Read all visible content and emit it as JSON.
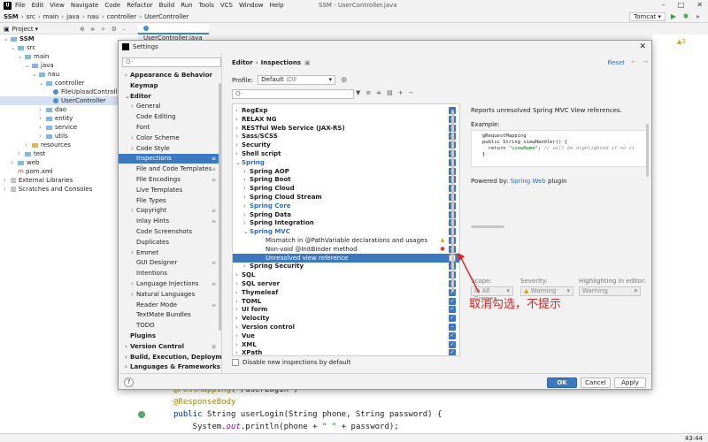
{
  "menubar": {
    "app_icon": "IJ",
    "items": [
      "File",
      "Edit",
      "View",
      "Navigate",
      "Code",
      "Refactor",
      "Build",
      "Run",
      "Tools",
      "VCS",
      "Window",
      "Help"
    ],
    "title": "SSM - UserController.java"
  },
  "navbar": {
    "crumbs": [
      "SSM",
      "src",
      "main",
      "java",
      "nau",
      "controller",
      "UserController"
    ],
    "run_config": "Tomcat"
  },
  "project_panel": {
    "title": "Project",
    "tree": [
      {
        "label": "SSM",
        "indent": 0,
        "arrow": "v",
        "kind": "folder"
      },
      {
        "label": "src",
        "indent": 1,
        "arrow": "v",
        "kind": "folder"
      },
      {
        "label": "main",
        "indent": 2,
        "arrow": "v",
        "kind": "folder"
      },
      {
        "label": "java",
        "indent": 3,
        "arrow": "v",
        "kind": "folder"
      },
      {
        "label": "nau",
        "indent": 4,
        "arrow": "v",
        "kind": "folder"
      },
      {
        "label": "controller",
        "indent": 5,
        "arrow": "v",
        "kind": "folder"
      },
      {
        "label": "FileUploadController",
        "indent": 6,
        "arrow": "",
        "kind": "class"
      },
      {
        "label": "UserController",
        "indent": 6,
        "arrow": "",
        "kind": "class",
        "selected": true
      },
      {
        "label": "dao",
        "indent": 5,
        "arrow": ">",
        "kind": "folder"
      },
      {
        "label": "entity",
        "indent": 5,
        "arrow": ">",
        "kind": "folder"
      },
      {
        "label": "service",
        "indent": 5,
        "arrow": ">",
        "kind": "folder"
      },
      {
        "label": "utils",
        "indent": 5,
        "arrow": ">",
        "kind": "folder"
      },
      {
        "label": "resources",
        "indent": 3,
        "arrow": ">",
        "kind": "folder-yellow"
      },
      {
        "label": "test",
        "indent": 2,
        "arrow": ">",
        "kind": "folder"
      },
      {
        "label": "web",
        "indent": 1,
        "arrow": ">",
        "kind": "folder"
      },
      {
        "label": "pom.xml",
        "indent": 1,
        "arrow": "",
        "kind": "file"
      },
      {
        "label": "External Libraries",
        "indent": 0,
        "arrow": ">",
        "kind": "lib"
      },
      {
        "label": "Scratches and Consoles",
        "indent": 0,
        "arrow": ">",
        "kind": "lib"
      }
    ]
  },
  "editor": {
    "tab": "UserController.java",
    "lines": [
      {
        "parts": [
          [
            "ann",
            "@PostMapping"
          ],
          [
            "",
            "(\"/userLogin\")"
          ]
        ]
      },
      {
        "parts": [
          [
            "ann",
            "@ResponseBody"
          ]
        ]
      },
      {
        "parts": [
          [
            "kw",
            "public "
          ],
          [
            "",
            "String userLogin(String phone, String password) {"
          ]
        ]
      },
      {
        "parts": [
          [
            "",
            "    System."
          ],
          [
            "fld",
            "out"
          ],
          [
            "",
            ".println(phone + "
          ],
          [
            "str",
            "\" \""
          ],
          [
            "",
            " + password);"
          ]
        ]
      }
    ],
    "warning_count": "3",
    "cursor_position": "43:44"
  },
  "settings": {
    "title": "Settings",
    "search_placeholder": "Q-",
    "nav": [
      {
        "label": "Appearance & Behavior",
        "level": 0,
        "bold": true,
        "ex": ">"
      },
      {
        "label": "Keymap",
        "level": 0,
        "bold": true,
        "ex": ""
      },
      {
        "label": "Editor",
        "level": 0,
        "bold": true,
        "ex": "v"
      },
      {
        "label": "General",
        "level": 1,
        "ex": ">"
      },
      {
        "label": "Code Editing",
        "level": 1,
        "ex": ""
      },
      {
        "label": "Font",
        "level": 1,
        "ex": ""
      },
      {
        "label": "Color Scheme",
        "level": 1,
        "ex": ">"
      },
      {
        "label": "Code Style",
        "level": 1,
        "ex": ">"
      },
      {
        "label": "Inspections",
        "level": 1,
        "ex": "",
        "selected": true,
        "mark": "≡"
      },
      {
        "label": "File and Code Templates",
        "level": 1,
        "ex": "",
        "mark": "≡"
      },
      {
        "label": "File Encodings",
        "level": 1,
        "ex": "",
        "mark": "≡"
      },
      {
        "label": "Live Templates",
        "level": 1,
        "ex": ""
      },
      {
        "label": "File Types",
        "level": 1,
        "ex": ""
      },
      {
        "label": "Copyright",
        "level": 1,
        "ex": ">",
        "mark": "≡"
      },
      {
        "label": "Inlay Hints",
        "level": 1,
        "ex": "",
        "mark": "≡"
      },
      {
        "label": "Code Screenshots",
        "level": 1,
        "ex": ""
      },
      {
        "label": "Duplicates",
        "level": 1,
        "ex": ""
      },
      {
        "label": "Emmet",
        "level": 1,
        "ex": ">"
      },
      {
        "label": "GUI Designer",
        "level": 1,
        "ex": "",
        "mark": "≡"
      },
      {
        "label": "Intentions",
        "level": 1,
        "ex": ""
      },
      {
        "label": "Language Injections",
        "level": 1,
        "ex": ">",
        "mark": "≡"
      },
      {
        "label": "Natural Languages",
        "level": 1,
        "ex": ">"
      },
      {
        "label": "Reader Mode",
        "level": 1,
        "ex": "",
        "mark": "≡"
      },
      {
        "label": "TextMate Bundles",
        "level": 1,
        "ex": ""
      },
      {
        "label": "TODO",
        "level": 1,
        "ex": ""
      },
      {
        "label": "Plugins",
        "level": 0,
        "bold": true,
        "ex": ""
      },
      {
        "label": "Version Control",
        "level": 0,
        "bold": true,
        "ex": ">",
        "mark": "≡"
      },
      {
        "label": "Build, Execution, Deployment",
        "level": 0,
        "bold": true,
        "ex": ">"
      },
      {
        "label": "Languages & Frameworks",
        "level": 0,
        "bold": true,
        "ex": ">"
      }
    ],
    "breadcrumb": [
      "Editor",
      "Inspections"
    ],
    "reset_label": "Reset",
    "profile_label": "Profile:",
    "profile_value": "Default",
    "profile_scope": "IDE",
    "inspection_search_placeholder": "Q-",
    "inspections": [
      {
        "label": "RegExp",
        "level": 0,
        "ex": ">",
        "bold": true,
        "check": "mixed"
      },
      {
        "label": "RELAX NG",
        "level": 0,
        "ex": ">",
        "bold": true,
        "check": "on"
      },
      {
        "label": "RESTful Web Service (JAX-RS)",
        "level": 0,
        "ex": ">",
        "bold": true,
        "check": "on"
      },
      {
        "label": "Sass/SCSS",
        "level": 0,
        "ex": ">",
        "bold": true,
        "check": "on"
      },
      {
        "label": "Security",
        "level": 0,
        "ex": ">",
        "bold": true,
        "check": "mixed"
      },
      {
        "label": "Shell script",
        "level": 0,
        "ex": ">",
        "bold": true,
        "check": "on"
      },
      {
        "label": "Spring",
        "level": 0,
        "ex": "v",
        "bold": true,
        "blue": true,
        "check": "mixed"
      },
      {
        "label": "Spring AOP",
        "level": 1,
        "ex": ">",
        "bold": true,
        "check": "on"
      },
      {
        "label": "Spring Boot",
        "level": 1,
        "ex": ">",
        "bold": true,
        "check": "on"
      },
      {
        "label": "Spring Cloud",
        "level": 1,
        "ex": ">",
        "bold": true,
        "check": "on"
      },
      {
        "label": "Spring Cloud Stream",
        "level": 1,
        "ex": ">",
        "bold": true,
        "check": "on"
      },
      {
        "label": "Spring Core",
        "level": 1,
        "ex": ">",
        "bold": true,
        "blue": true,
        "check": "mixed"
      },
      {
        "label": "Spring Data",
        "level": 1,
        "ex": ">",
        "bold": true,
        "check": "on"
      },
      {
        "label": "Spring Integration",
        "level": 1,
        "ex": ">",
        "bold": true,
        "check": "on"
      },
      {
        "label": "Spring MVC",
        "level": 1,
        "ex": "v",
        "bold": true,
        "blue": true,
        "check": "mixed"
      },
      {
        "label": "Mismatch in @PathVariable declarations and usages",
        "level": 2,
        "ex": "",
        "sev": "warn",
        "check": "on"
      },
      {
        "label": "Non-void @InitBinder method",
        "level": 2,
        "ex": "",
        "sev": "err",
        "check": "on"
      },
      {
        "label": "Unresolved view reference",
        "level": 2,
        "ex": "",
        "selected": true,
        "check": "off"
      },
      {
        "label": "Spring Security",
        "level": 1,
        "ex": ">",
        "bold": true,
        "check": "on"
      },
      {
        "label": "SQL",
        "level": 0,
        "ex": ">",
        "bold": true,
        "check": "mixed"
      },
      {
        "label": "SQL server",
        "level": 0,
        "ex": ">",
        "bold": true,
        "check": "on"
      },
      {
        "label": "Thymeleaf",
        "level": 0,
        "ex": ">",
        "bold": true,
        "check": "on"
      },
      {
        "label": "TOML",
        "level": 0,
        "ex": ">",
        "bold": true,
        "check": "on"
      },
      {
        "label": "UI form",
        "level": 0,
        "ex": ">",
        "bold": true,
        "check": "on"
      },
      {
        "label": "Velocity",
        "level": 0,
        "ex": ">",
        "bold": true,
        "check": "on"
      },
      {
        "label": "Version control",
        "level": 0,
        "ex": ">",
        "bold": true,
        "check": "mixed"
      },
      {
        "label": "Vue",
        "level": 0,
        "ex": ">",
        "bold": true,
        "check": "on"
      },
      {
        "label": "XML",
        "level": 0,
        "ex": ">",
        "bold": true,
        "check": "on"
      },
      {
        "label": "XPath",
        "level": 0,
        "ex": ">",
        "bold": true,
        "check": "on"
      }
    ],
    "disable_new_label": "Disable new inspections by default",
    "description": {
      "summary": "Reports unresolved Spring MVC View references.",
      "example_label": "Example:",
      "code": [
        [
          [
            "",
            "@RequestMapping"
          ]
        ],
        [
          [
            "",
            "public String viewHandler() {"
          ]
        ],
        [
          [
            "",
            "  return "
          ],
          [
            "str",
            "\"viewName\""
          ],
          [
            "",
            "; "
          ],
          [
            "cm",
            "// will be highlighted if no vi"
          ]
        ],
        [
          [
            "",
            "}"
          ]
        ]
      ],
      "powered_prefix": "Powered by: ",
      "powered_link": "Spring Web",
      "powered_suffix": " plugin"
    },
    "options": {
      "scope_label": "Scope:",
      "scope_value": "In All Scopes",
      "severity_label": "Severity:",
      "severity_value": "Warning",
      "highlight_label": "Highlighting in editor:",
      "highlight_value": "Warning"
    },
    "help_label": "?",
    "ok_label": "OK",
    "cancel_label": "Cancel",
    "apply_label": "Apply"
  },
  "annotation": {
    "text": "取消勾选，不提示",
    "color": "#e62020"
  }
}
